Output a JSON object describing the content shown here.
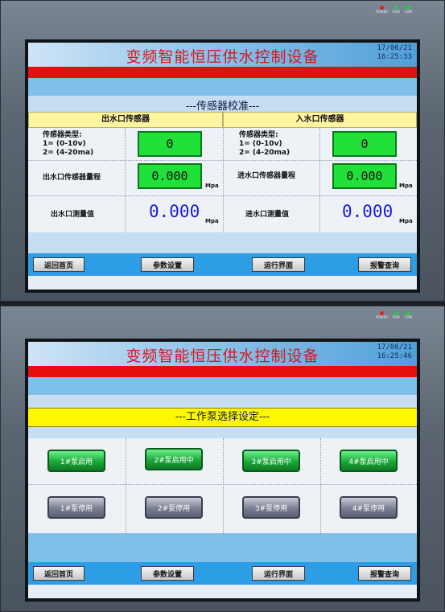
{
  "screen1": {
    "title": "变频智能恒压供水控制设备",
    "date": "17/06/21",
    "time": "16:25:33",
    "indicators": [
      "POWER",
      "RUN",
      "COM"
    ],
    "section_title": "---传感器校准---",
    "outlet": {
      "header": "出水口传感器",
      "type_label": [
        "传感器类型:",
        "1= (0-10v)",
        "2= (4-20ma)"
      ],
      "type_value": "0",
      "range_label": "出水口传感器量程",
      "range_value": "0.000",
      "range_unit": "Mpa",
      "measure_label": "出水口测量值",
      "measure_value": "0.000",
      "measure_unit": "Mpa"
    },
    "inlet": {
      "header": "入水口传感器",
      "type_label": [
        "传感器类型:",
        "1= (0-10v)",
        "2= (4-20ma)"
      ],
      "type_value": "0",
      "range_label": "进水口传感器量程",
      "range_value": "0.000",
      "range_unit": "Mpa",
      "measure_label": "进水口测量值",
      "measure_value": "0.000",
      "measure_unit": "Mpa"
    },
    "nav": [
      "返回首页",
      "参数设置",
      "运行界面",
      "报警查询"
    ]
  },
  "screen2": {
    "title": "变频智能恒压供水控制设备",
    "date": "17/06/21",
    "time": "16:25:46",
    "indicators": [
      "POWER",
      "RUN",
      "COM"
    ],
    "section_title": "---工作泵选择设定---",
    "pumps_on": [
      "1#泵启用",
      "2#泵启用中",
      "3#泵启用中",
      "4#泵启用中"
    ],
    "pumps_off": [
      "1#泵停用",
      "2#泵停用",
      "3#泵停用",
      "4#泵停用"
    ],
    "nav": [
      "返回首页",
      "参数设置",
      "运行界面",
      "报警查询"
    ]
  },
  "colors": {
    "title_red": "#d01a1a",
    "strip_red": "#e60f0f",
    "value_blue": "#1a1ad8",
    "box_green": "#22e03a",
    "nav_blue": "#2d9de6",
    "yellow": "#fff700"
  }
}
